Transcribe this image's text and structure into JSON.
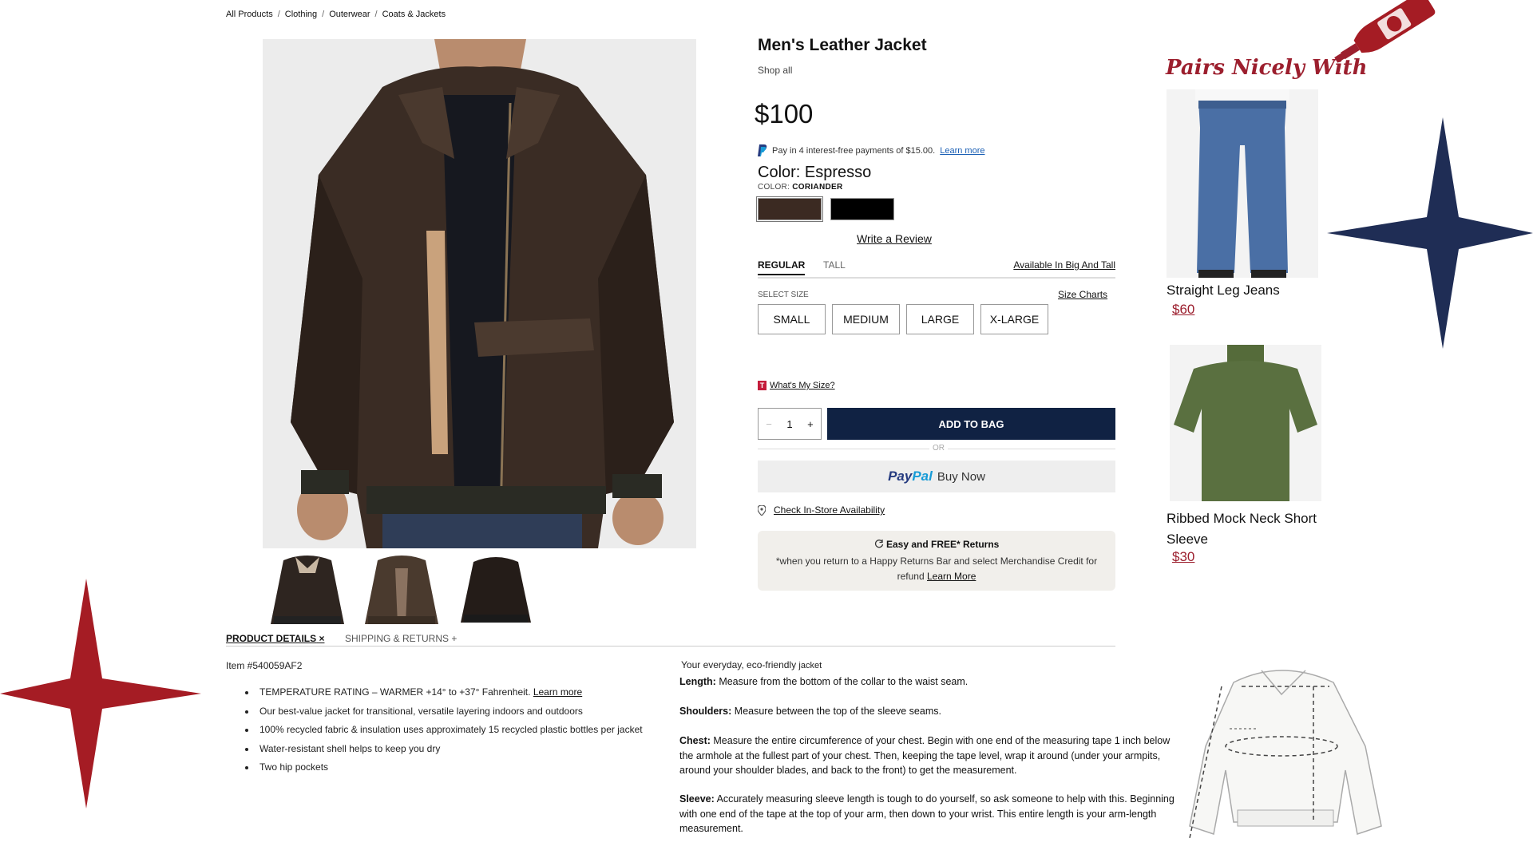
{
  "breadcrumb": [
    "All Products",
    "Clothing",
    "Outerwear",
    "Coats & Jackets"
  ],
  "product": {
    "title": "Men's Leather Jacket",
    "shop_all": "Shop all",
    "price": "$100",
    "paypal_installment": "Pay in 4 interest-free payments of $15.00.",
    "paypal_learn_more": "Learn more",
    "color_title": "Color: Espresso",
    "color_sub_label": "COLOR:",
    "color_sub_value": "CORIANDER",
    "swatches": [
      {
        "name": "espresso",
        "color": "#3b2a22"
      },
      {
        "name": "black",
        "color": "#000000"
      }
    ],
    "write_review": "Write a Review",
    "fit_tabs": [
      "REGULAR",
      "TALL"
    ],
    "big_tall": "Available In Big And Tall",
    "select_size": "SELECT SIZE",
    "size_charts": "Size Charts",
    "sizes": [
      "SMALL",
      "MEDIUM",
      "LARGE",
      "X-LARGE"
    ],
    "whats_my_size": "What's My Size?",
    "quantity": "1",
    "add_to_bag": "ADD TO BAG",
    "or": "OR",
    "paypal_brand_1": "Pay",
    "paypal_brand_2": "Pal",
    "buy_now": "Buy Now",
    "check_store": "Check In-Store Availability",
    "returns_head": "Easy and FREE* Returns",
    "returns_body": "*when you return to a Happy Returns Bar and select Merchandise Credit for refund",
    "returns_link": "Learn More"
  },
  "pairs": {
    "title": "Pairs Nicely With",
    "items": [
      {
        "name": "Straight Leg Jeans",
        "price": "$60"
      },
      {
        "name": "Ribbed Mock Neck Short Sleeve",
        "price": "$30"
      }
    ]
  },
  "details": {
    "tabs": [
      "PRODUCT DETAILS",
      "SHIPPING & RETURNS"
    ],
    "item_number": "Item #540059AF2",
    "bullets": [
      "TEMPERATURE RATING – WARMER +14° to +37° Fahrenheit.",
      "Our best-value jacket for transitional, versatile layering indoors and outdoors",
      "100% recycled fabric & insulation uses approximately 15 recycled plastic bottles per jacket",
      "Water-resistant shell helps to keep you dry",
      "Two hip pockets"
    ],
    "bullet_link": "Learn more",
    "tagline_1": "Your everyday, eco-friendly",
    "tagline_2": "jacket",
    "measurements": [
      {
        "label": "Length:",
        "text": "Measure from the bottom of the collar to the waist seam."
      },
      {
        "label": "Shoulders:",
        "text": "Measure between the top of the sleeve seams."
      },
      {
        "label": "Chest:",
        "text": "Measure the entire circumference of your chest. Begin with one end of the measuring tape 1 inch below the armhole at the fullest part of your chest. Then, keeping the tape level, wrap it around (under your armpits, around your shoulder blades, and back to the front) to get the measurement."
      },
      {
        "label": "Sleeve:",
        "text": "Accurately measuring sleeve length is tough to do yourself, so ask someone to help with this. Beginning with one end of the tape at the top of your arm, then down to your wrist. This entire length is your arm-length measurement."
      }
    ]
  },
  "colors": {
    "navy": "#102243",
    "star_red": "#a51c24",
    "star_navy": "#1f2d55",
    "brand_red": "#9c1f2e",
    "link_blue": "#1a5fb4"
  }
}
